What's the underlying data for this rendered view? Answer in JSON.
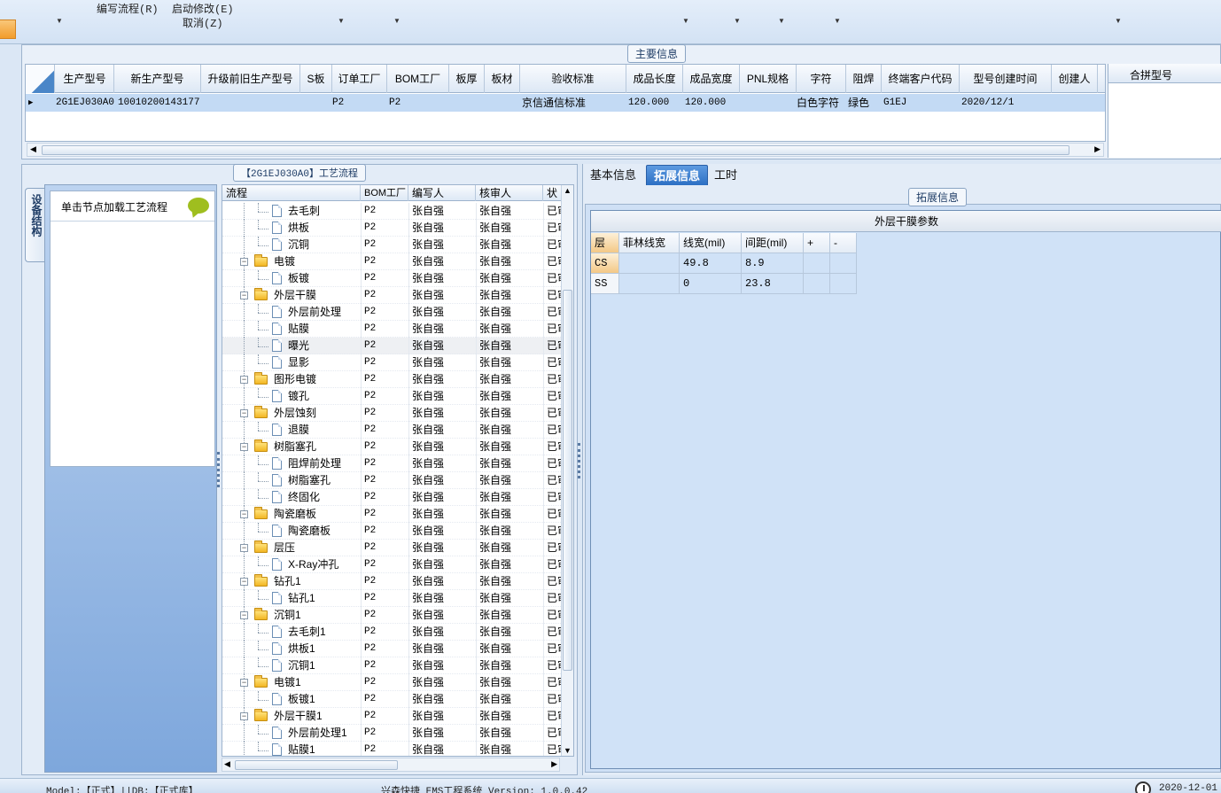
{
  "ribbon": {
    "write_flow": "编写流程(R)",
    "start_modify": "启动修改(E)",
    "cancel": "取消(Z)"
  },
  "main_info": {
    "title": "主要信息",
    "columns": [
      "生产型号",
      "新生产型号",
      "升级前旧生产型号",
      "S板",
      "订单工厂",
      "BOM工厂",
      "板厚",
      "板材",
      "验收标准",
      "成品长度",
      "成品宽度",
      "PNL规格",
      "字符",
      "阻焊",
      "终端客户代码",
      "型号创建时间",
      "创建人"
    ],
    "row": {
      "model": "2G1EJ030A0",
      "new_model": "10010200143177",
      "old_model": "",
      "s_board": "",
      "order_factory": "P2",
      "bom_factory": "P2",
      "thickness": "",
      "material": "",
      "acceptance": "京信通信标准",
      "length": "120.000",
      "width": "120.000",
      "pnl": "",
      "char": "白色字符",
      "solder_mask": "绿色",
      "customer_code": "G1EJ",
      "created": "2020/12/1",
      "creator": ""
    },
    "merge_label": "合拼型号"
  },
  "process": {
    "title": "【2G1EJ030A0】工艺流程",
    "side_tab": "设备结构",
    "node_hint": "单击节点加载工艺流程",
    "columns": [
      "流程",
      "BOM工厂",
      "编写人",
      "核审人",
      "状"
    ],
    "rows": [
      {
        "name": "去毛刺",
        "type": "doc",
        "level": 2,
        "bom": "P2",
        "writer": "张自强",
        "checker": "张自强",
        "status": "已审"
      },
      {
        "name": "烘板",
        "type": "doc",
        "level": 2,
        "bom": "P2",
        "writer": "张自强",
        "checker": "张自强",
        "status": "已审"
      },
      {
        "name": "沉铜",
        "type": "doc",
        "level": 2,
        "bom": "P2",
        "writer": "张自强",
        "checker": "张自强",
        "status": "已审"
      },
      {
        "name": "电镀",
        "type": "folder",
        "level": 1,
        "bom": "P2",
        "writer": "张自强",
        "checker": "张自强",
        "status": "已审"
      },
      {
        "name": "板镀",
        "type": "doc",
        "level": 2,
        "bom": "P2",
        "writer": "张自强",
        "checker": "张自强",
        "status": "已审"
      },
      {
        "name": "外层干膜",
        "type": "folder",
        "level": 1,
        "bom": "P2",
        "writer": "张自强",
        "checker": "张自强",
        "status": "已审"
      },
      {
        "name": "外层前处理",
        "type": "doc",
        "level": 2,
        "bom": "P2",
        "writer": "张自强",
        "checker": "张自强",
        "status": "已审"
      },
      {
        "name": "贴膜",
        "type": "doc",
        "level": 2,
        "bom": "P2",
        "writer": "张自强",
        "checker": "张自强",
        "status": "已审"
      },
      {
        "name": "曝光",
        "type": "doc",
        "level": 2,
        "bom": "P2",
        "writer": "张自强",
        "checker": "张自强",
        "status": "已审",
        "selected": true
      },
      {
        "name": "显影",
        "type": "doc",
        "level": 2,
        "bom": "P2",
        "writer": "张自强",
        "checker": "张自强",
        "status": "已审"
      },
      {
        "name": "图形电镀",
        "type": "folder",
        "level": 1,
        "bom": "P2",
        "writer": "张自强",
        "checker": "张自强",
        "status": "已审"
      },
      {
        "name": "镀孔",
        "type": "doc",
        "level": 2,
        "bom": "P2",
        "writer": "张自强",
        "checker": "张自强",
        "status": "已审"
      },
      {
        "name": "外层蚀刻",
        "type": "folder",
        "level": 1,
        "bom": "P2",
        "writer": "张自强",
        "checker": "张自强",
        "status": "已审"
      },
      {
        "name": "退膜",
        "type": "doc",
        "level": 2,
        "bom": "P2",
        "writer": "张自强",
        "checker": "张自强",
        "status": "已审"
      },
      {
        "name": "树脂塞孔",
        "type": "folder",
        "level": 1,
        "bom": "P2",
        "writer": "张自强",
        "checker": "张自强",
        "status": "已审"
      },
      {
        "name": "阻焊前处理",
        "type": "doc",
        "level": 2,
        "bom": "P2",
        "writer": "张自强",
        "checker": "张自强",
        "status": "已审"
      },
      {
        "name": "树脂塞孔",
        "type": "doc",
        "level": 2,
        "bom": "P2",
        "writer": "张自强",
        "checker": "张自强",
        "status": "已审"
      },
      {
        "name": "终固化",
        "type": "doc",
        "level": 2,
        "bom": "P2",
        "writer": "张自强",
        "checker": "张自强",
        "status": "已审"
      },
      {
        "name": "陶瓷磨板",
        "type": "folder",
        "level": 1,
        "bom": "P2",
        "writer": "张自强",
        "checker": "张自强",
        "status": "已审"
      },
      {
        "name": "陶瓷磨板",
        "type": "doc",
        "level": 2,
        "bom": "P2",
        "writer": "张自强",
        "checker": "张自强",
        "status": "已审"
      },
      {
        "name": "层压",
        "type": "folder",
        "level": 1,
        "bom": "P2",
        "writer": "张自强",
        "checker": "张自强",
        "status": "已审"
      },
      {
        "name": "X-Ray冲孔",
        "type": "doc",
        "level": 2,
        "bom": "P2",
        "writer": "张自强",
        "checker": "张自强",
        "status": "已审"
      },
      {
        "name": "钻孔1",
        "type": "folder",
        "level": 1,
        "bom": "P2",
        "writer": "张自强",
        "checker": "张自强",
        "status": "已审"
      },
      {
        "name": "钻孔1",
        "type": "doc",
        "level": 2,
        "bom": "P2",
        "writer": "张自强",
        "checker": "张自强",
        "status": "已审"
      },
      {
        "name": "沉铜1",
        "type": "folder",
        "level": 1,
        "bom": "P2",
        "writer": "张自强",
        "checker": "张自强",
        "status": "已审"
      },
      {
        "name": "去毛刺1",
        "type": "doc",
        "level": 2,
        "bom": "P2",
        "writer": "张自强",
        "checker": "张自强",
        "status": "已审"
      },
      {
        "name": "烘板1",
        "type": "doc",
        "level": 2,
        "bom": "P2",
        "writer": "张自强",
        "checker": "张自强",
        "status": "已审"
      },
      {
        "name": "沉铜1",
        "type": "doc",
        "level": 2,
        "bom": "P2",
        "writer": "张自强",
        "checker": "张自强",
        "status": "已审"
      },
      {
        "name": "电镀1",
        "type": "folder",
        "level": 1,
        "bom": "P2",
        "writer": "张自强",
        "checker": "张自强",
        "status": "已审"
      },
      {
        "name": "板镀1",
        "type": "doc",
        "level": 2,
        "bom": "P2",
        "writer": "张自强",
        "checker": "张自强",
        "status": "已审"
      },
      {
        "name": "外层干膜1",
        "type": "folder",
        "level": 1,
        "bom": "P2",
        "writer": "张自强",
        "checker": "张自强",
        "status": "已审"
      },
      {
        "name": "外层前处理1",
        "type": "doc",
        "level": 2,
        "bom": "P2",
        "writer": "张自强",
        "checker": "张自强",
        "status": "已审"
      },
      {
        "name": "贴膜1",
        "type": "doc",
        "level": 2,
        "bom": "P2",
        "writer": "张自强",
        "checker": "张自强",
        "status": "已审"
      }
    ]
  },
  "right": {
    "tabs": [
      "基本信息",
      "拓展信息",
      "工时"
    ],
    "active_tab": 1,
    "ext_title": "拓展信息",
    "dry_film": {
      "title": "外层干膜参数",
      "columns": [
        "层",
        "菲林线宽",
        "线宽(mil)",
        "间距(mil)",
        "+",
        "-"
      ],
      "rows": [
        {
          "layer": "CS",
          "film": "",
          "width": "49.8",
          "spacing": "8.9"
        },
        {
          "layer": "SS",
          "film": "",
          "width": "0",
          "spacing": "23.8"
        }
      ]
    }
  },
  "status": {
    "model_db": "Model:【正式】||DB:【正式库】",
    "app": "兴森快捷 EMS工程系统 Version: 1.0.0.42",
    "date": "2020-12-01 2"
  }
}
